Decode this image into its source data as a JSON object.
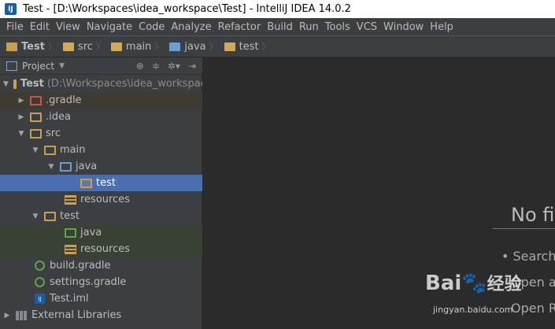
{
  "window": {
    "title": "Test - [D:\\Workspaces\\idea_workspace\\Test] - IntelliJ IDEA 14.0.2"
  },
  "menu": [
    "File",
    "Edit",
    "View",
    "Navigate",
    "Code",
    "Analyze",
    "Refactor",
    "Build",
    "Run",
    "Tools",
    "VCS",
    "Window",
    "Help"
  ],
  "breadcrumb": [
    "Test",
    "src",
    "main",
    "java",
    "test"
  ],
  "project_panel": {
    "title": "Project"
  },
  "tree": [
    {
      "label": "Test",
      "path": "(D:\\Workspaces\\idea_workspac"
    },
    {
      "label": ".gradle"
    },
    {
      "label": ".idea"
    },
    {
      "label": "src"
    },
    {
      "label": "main"
    },
    {
      "label": "java"
    },
    {
      "label": "test"
    },
    {
      "label": "resources"
    },
    {
      "label": "test"
    },
    {
      "label": "java"
    },
    {
      "label": "resources"
    },
    {
      "label": "build.gradle"
    },
    {
      "label": "settings.gradle"
    },
    {
      "label": "Test.iml"
    },
    {
      "label": "External Libraries"
    }
  ],
  "editor": {
    "empty_title": "No fi",
    "hint1": "• Search",
    "hint2": "Open a",
    "hint3": "Open R"
  },
  "watermark": {
    "brand": "Bai",
    "sub": "jingyan.baidu.com",
    "cn": "经验"
  }
}
